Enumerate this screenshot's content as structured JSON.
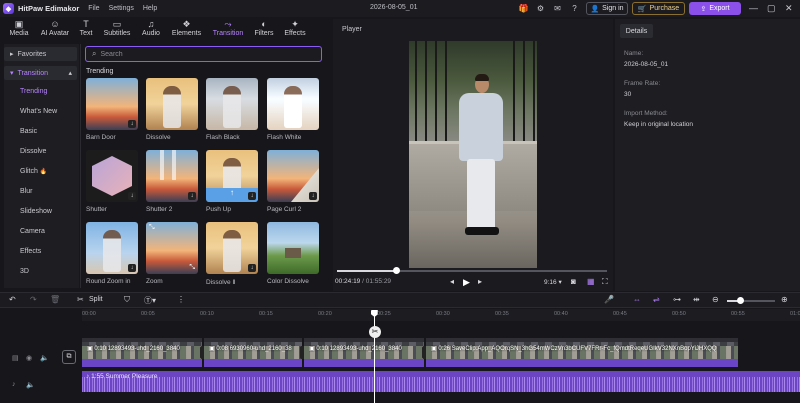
{
  "app": {
    "title": "HitPaw Edimakor",
    "menus": [
      "File",
      "Settings",
      "Help"
    ],
    "project_name": "2026-08-05_01",
    "sign_in": "Sign in",
    "purchase": "Purchase",
    "export": "Export"
  },
  "top_tabs": [
    {
      "label": "Media",
      "icon": "media-icon"
    },
    {
      "label": "AI Avatar",
      "icon": "avatar-icon"
    },
    {
      "label": "Text",
      "icon": "text-icon"
    },
    {
      "label": "Subtitles",
      "icon": "subtitles-icon"
    },
    {
      "label": "Audio",
      "icon": "audio-icon"
    },
    {
      "label": "Elements",
      "icon": "elements-icon"
    },
    {
      "label": "Transition",
      "icon": "transition-icon",
      "active": true
    },
    {
      "label": "Filters",
      "icon": "filters-icon"
    },
    {
      "label": "Effects",
      "icon": "effects-icon"
    }
  ],
  "sidebar": {
    "favorites": "Favorites",
    "transition": "Transition",
    "items": [
      "Trending",
      "What's New",
      "Basic",
      "Dissolve",
      "Glitch",
      "Blur",
      "Slideshow",
      "Camera",
      "Effects",
      "3D"
    ],
    "glitch_badge": "🔥"
  },
  "search": {
    "placeholder": "Search"
  },
  "section_title": "Trending",
  "tiles": [
    {
      "label": "Barn Door"
    },
    {
      "label": "Dissolve"
    },
    {
      "label": "Flash Black"
    },
    {
      "label": "Flash White"
    },
    {
      "label": "Shutter"
    },
    {
      "label": "Shutter 2"
    },
    {
      "label": "Push Up"
    },
    {
      "label": "Page Curl 2"
    },
    {
      "label": "Round Zoom in"
    },
    {
      "label": "Zoom"
    },
    {
      "label": "Dissolve Ⅱ"
    },
    {
      "label": "Color Dissolve"
    }
  ],
  "player": {
    "title": "Player",
    "current_time": "00:24:19",
    "total_time": "01:55:29",
    "ratio": "9:16",
    "progress_fraction": 0.22
  },
  "details": {
    "tab": "Details",
    "name_label": "Name:",
    "name_value": "2026-08-05_01",
    "frame_rate_label": "Frame Rate:",
    "frame_rate_value": "30",
    "import_label": "Import Method:",
    "import_value": "Keep in original location"
  },
  "toolbar": {
    "split": "Split"
  },
  "ruler": [
    "00:00",
    "00:05",
    "00:10",
    "00:15",
    "00:20",
    "00:25",
    "00:30",
    "00:35",
    "00:40",
    "00:45",
    "00:50",
    "00:55",
    "01:00",
    "01:05",
    "01:10",
    "01:15"
  ],
  "clips": [
    {
      "duration": "0:10",
      "name": "12893493-uhd_2160_3840"
    },
    {
      "duration": "0:08",
      "name": "6930960-uhd_2160_38"
    },
    {
      "duration": "0:10",
      "name": "12893493-uhd_2160_3840"
    },
    {
      "duration": "0:26",
      "name": "SaveClip.App_AQOrqSN_3hG54mWCzVn3bCUFV7FRr-Fc_fQmdtReqeUGIkV32NXnBopYiJHXQQ"
    }
  ],
  "audio_clip": {
    "label": "1:55 Summer Pleasure"
  },
  "colors": {
    "accent": "#8b4fea",
    "active_tab": "#b784ff",
    "audio": "#6b45c2"
  }
}
